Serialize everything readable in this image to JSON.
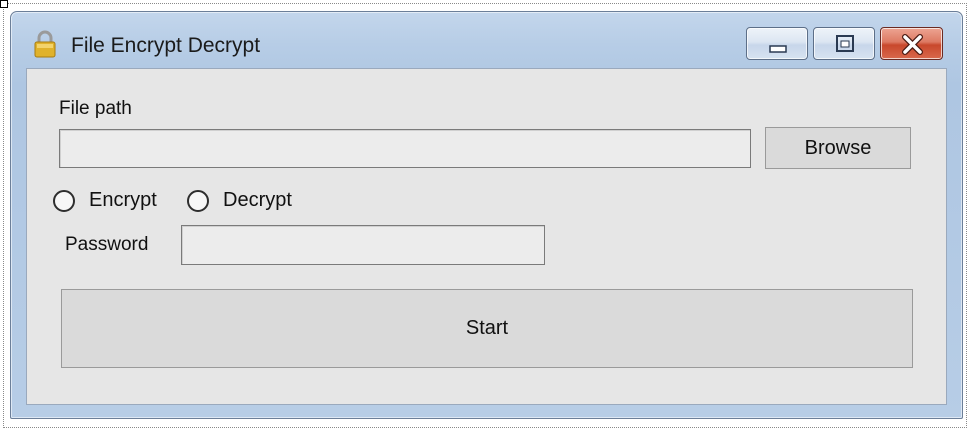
{
  "window": {
    "title": "File Encrypt Decrypt",
    "title_icon": "padlock-icon",
    "caption_icons": {
      "minimize": "minimize-icon",
      "maximize": "maximize-icon",
      "close": "close-icon"
    },
    "colors": {
      "frame": "#b7cde6",
      "client": "#e6e6e6",
      "close_button": "#c8482c"
    }
  },
  "form": {
    "file_path_label": "File path",
    "file_path_value": "",
    "browse_label": "Browse",
    "encrypt_label": "Encrypt",
    "encrypt_checked": false,
    "decrypt_label": "Decrypt",
    "decrypt_checked": false,
    "password_label": "Password",
    "password_value": "",
    "start_label": "Start"
  }
}
